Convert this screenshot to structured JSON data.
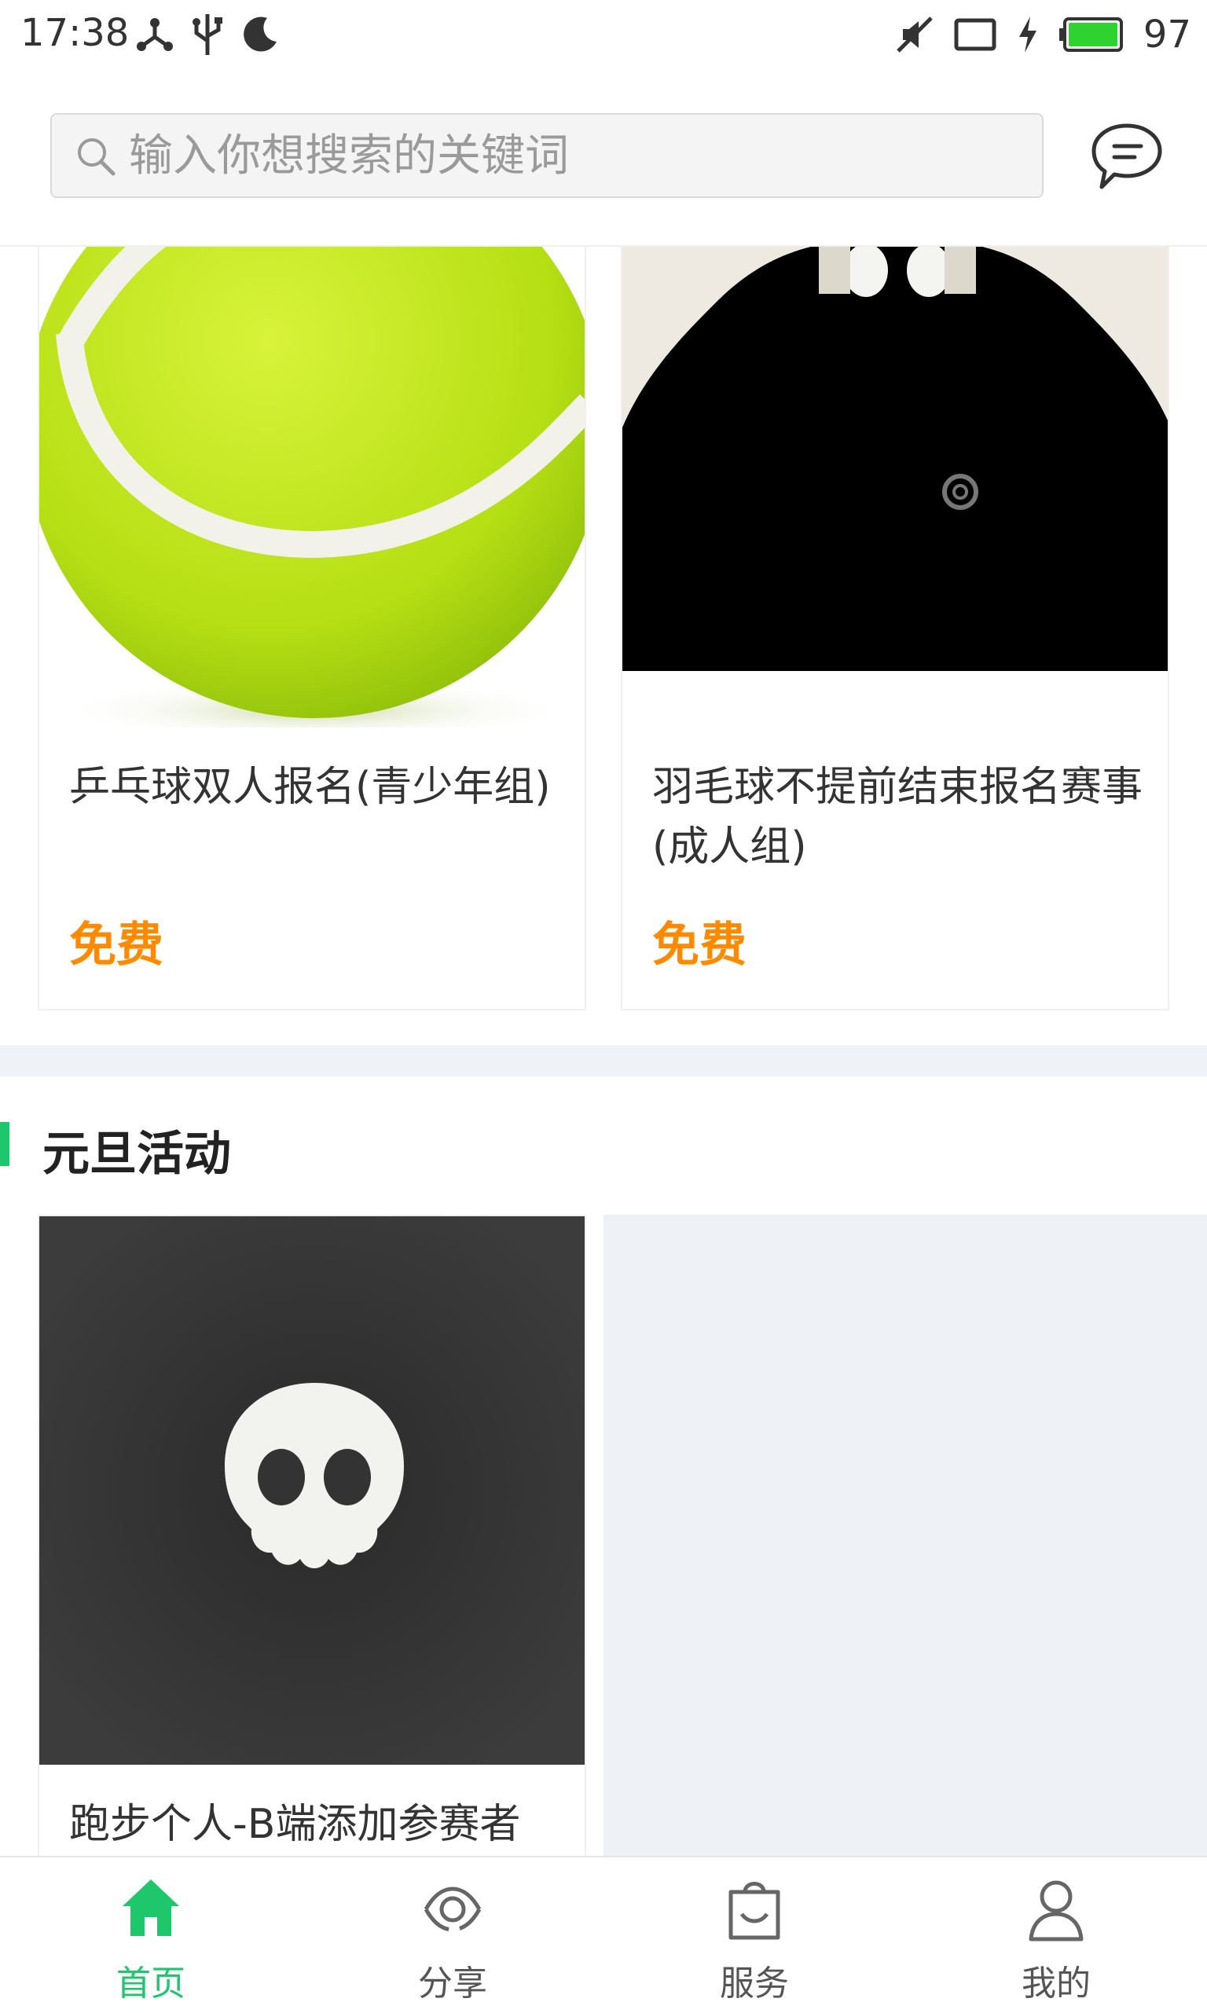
{
  "status_bar": {
    "time": "17:38",
    "battery": "97"
  },
  "search": {
    "placeholder": "输入你想搜索的关键词"
  },
  "cards_top": [
    {
      "title": "乒乓球双人报名(青少年组)",
      "price": "免费"
    },
    {
      "title": "羽毛球不提前结束报名赛事(成人组)",
      "price": "免费"
    }
  ],
  "section": {
    "title": "元旦活动"
  },
  "cards_section": [
    {
      "title": "跑步个人-B端添加参赛者"
    }
  ],
  "tabs": [
    {
      "label": "首页",
      "icon": "home-icon",
      "active": true
    },
    {
      "label": "分享",
      "icon": "share-eye-icon",
      "active": false
    },
    {
      "label": "服务",
      "icon": "shopping-bag-icon",
      "active": false
    },
    {
      "label": "我的",
      "icon": "user-icon",
      "active": false
    }
  ],
  "colors": {
    "accent": "#1ec76b",
    "price": "#ff8a00",
    "divider": "#eff2f6"
  }
}
